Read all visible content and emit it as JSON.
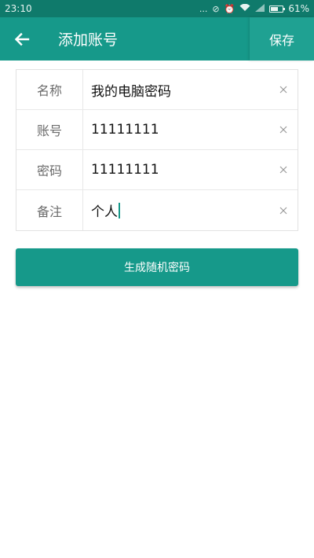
{
  "status_bar": {
    "time": "23:10",
    "dots": "...",
    "battery_text": "61%",
    "battery_level": 0.61
  },
  "app_bar": {
    "title": "添加账号",
    "save_label": "保存"
  },
  "form": {
    "rows": [
      {
        "label": "名称",
        "value": "我的电脑密码"
      },
      {
        "label": "账号",
        "value": "11111111"
      },
      {
        "label": "密码",
        "value": "11111111"
      },
      {
        "label": "备注",
        "value": "个人"
      }
    ]
  },
  "generate_button": {
    "label": "生成随机密码"
  },
  "colors": {
    "primary": "#16998a",
    "status_bar": "#0f7a6b"
  }
}
